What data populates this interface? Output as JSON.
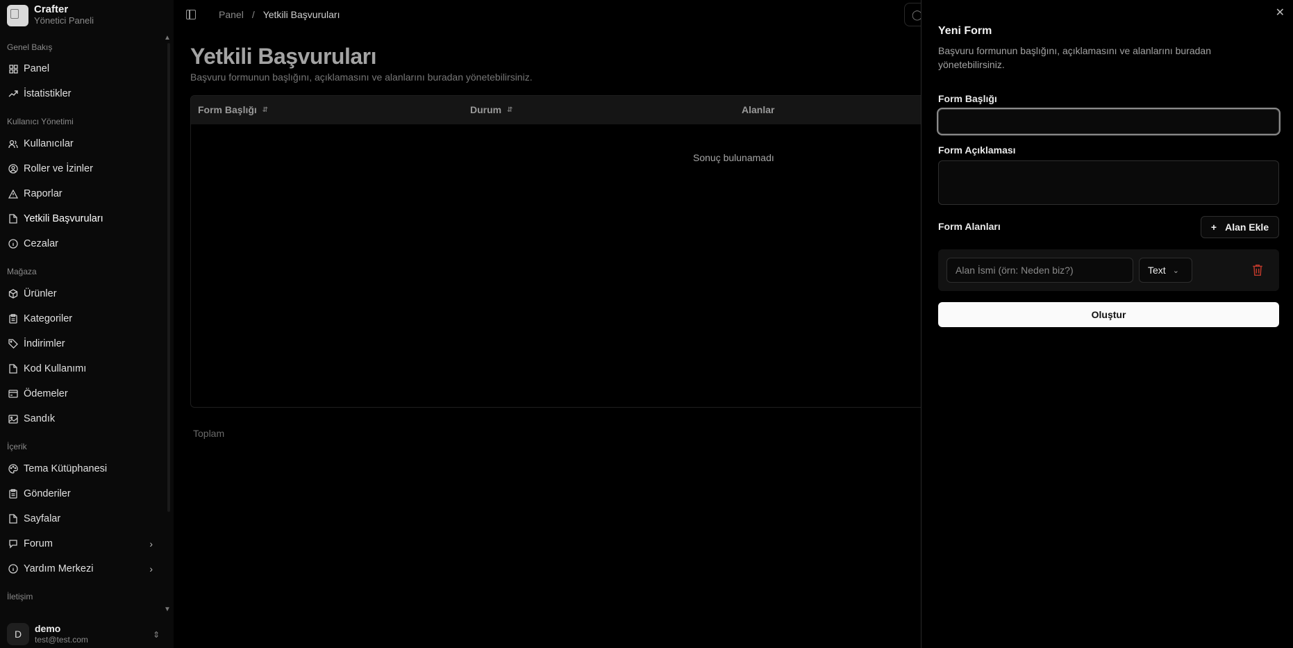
{
  "brand": {
    "name": "Crafter",
    "subtitle": "Yönetici Paneli"
  },
  "sidebar": {
    "sections": [
      {
        "title": "Genel Bakış",
        "items": [
          {
            "label": "Panel",
            "icon": "grid-icon"
          },
          {
            "label": "İstatistikler",
            "icon": "trend-icon"
          }
        ]
      },
      {
        "title": "Kullanıcı Yönetimi",
        "items": [
          {
            "label": "Kullanıcılar",
            "icon": "users-icon"
          },
          {
            "label": "Roller ve İzinler",
            "icon": "user-circle-icon"
          },
          {
            "label": "Raporlar",
            "icon": "alert-triangle-icon"
          },
          {
            "label": "Yetkili Başvuruları",
            "icon": "file-icon"
          },
          {
            "label": "Cezalar",
            "icon": "info-icon"
          }
        ]
      },
      {
        "title": "Mağaza",
        "items": [
          {
            "label": "Ürünler",
            "icon": "box-icon"
          },
          {
            "label": "Kategoriler",
            "icon": "clipboard-icon"
          },
          {
            "label": "İndirimler",
            "icon": "tag-icon"
          },
          {
            "label": "Kod Kullanımı",
            "icon": "file-icon"
          },
          {
            "label": "Ödemeler",
            "icon": "wallet-icon"
          },
          {
            "label": "Sandık",
            "icon": "image-icon"
          }
        ]
      },
      {
        "title": "İçerik",
        "items": [
          {
            "label": "Tema Kütüphanesi",
            "icon": "palette-icon"
          },
          {
            "label": "Gönderiler",
            "icon": "clipboard-icon"
          },
          {
            "label": "Sayfalar",
            "icon": "file-icon"
          },
          {
            "label": "Forum",
            "icon": "chat-icon"
          },
          {
            "label": "Yardım Merkezi",
            "icon": "info-icon"
          }
        ]
      },
      {
        "title": "İletişim",
        "items": []
      }
    ]
  },
  "user": {
    "initial": "D",
    "name": "demo",
    "email": "test@test.com"
  },
  "breadcrumb": {
    "root": "Panel",
    "current": "Yetkili Başvuruları"
  },
  "page": {
    "title": "Yetkili Başvuruları",
    "description": "Başvuru formunun başlığını, açıklamasını ve alanlarını buradan yönetebilirsiniz.",
    "table": {
      "columns": [
        "Form Başlığı",
        "Durum",
        "Alanlar"
      ],
      "empty_text": "Sonuç bulunamadı"
    },
    "total_label": "Toplam"
  },
  "sheet": {
    "title": "Yeni Form",
    "description": "Başvuru formunun başlığını, açıklamasını ve alanlarını buradan yönetebilirsiniz.",
    "form_title_label": "Form Başlığı",
    "form_title_value": "",
    "form_desc_label": "Form Açıklaması",
    "form_desc_value": "",
    "fields_label": "Form Alanları",
    "add_field_label": "Alan Ekle",
    "field_placeholder": "Alan İsmi (örn: Neden biz?)",
    "field_type": "Text",
    "submit_label": "Oluştur"
  }
}
